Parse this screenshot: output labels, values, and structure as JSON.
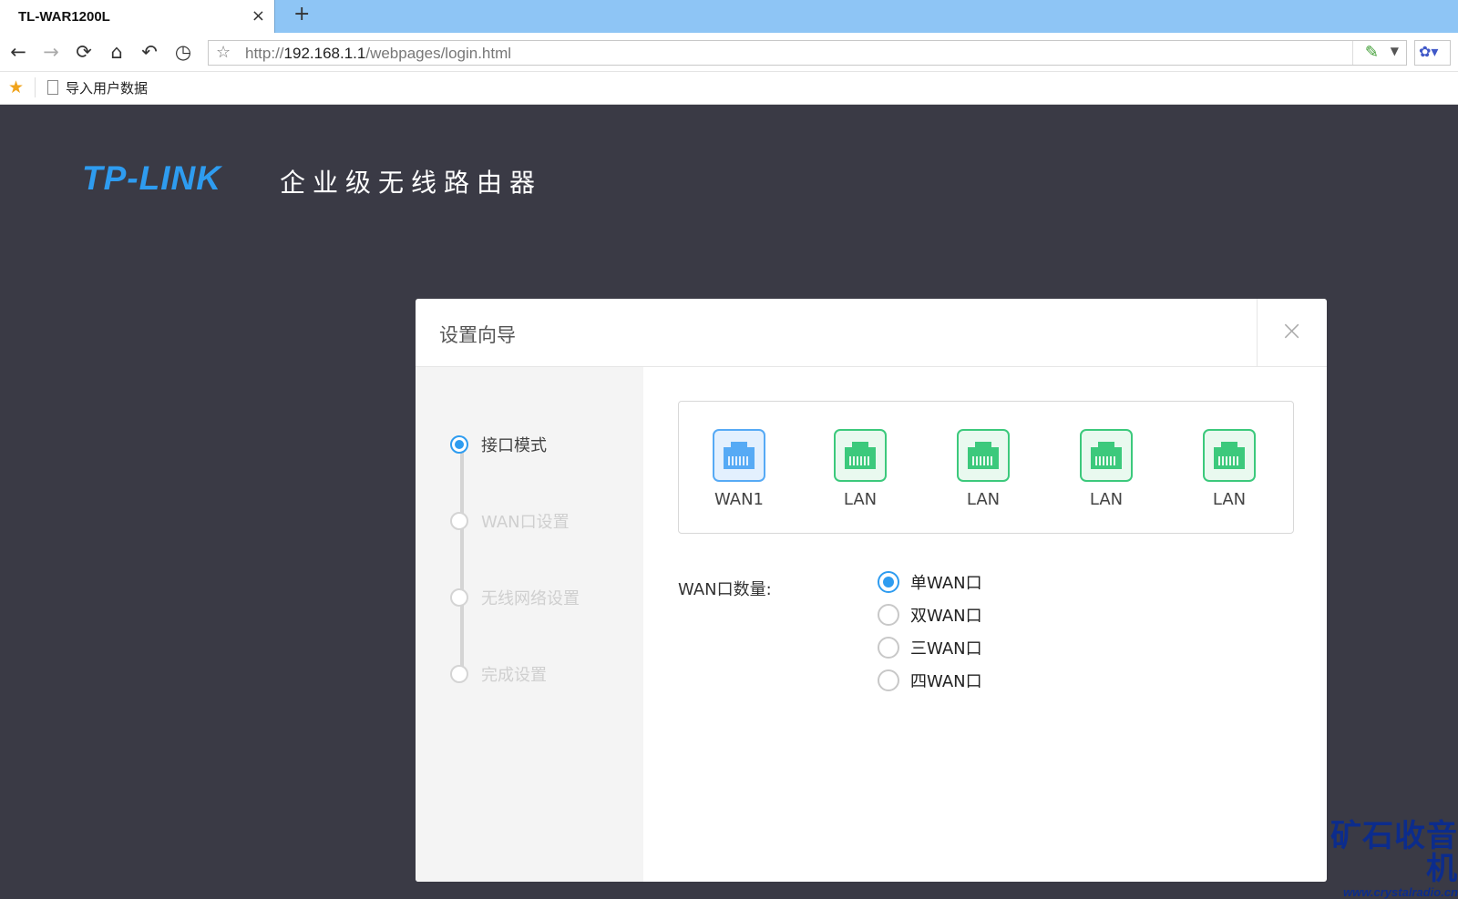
{
  "browser": {
    "tab_title": "TL-WAR1200L",
    "tab_close": "×",
    "new_tab": "+",
    "url_prefix": "http://",
    "url_host": "192.168.1.1",
    "url_path": "/webpages/login.html",
    "bookmark_label": "导入用户数据"
  },
  "header": {
    "logo": "TP-LINK",
    "product": "企业级无线路由器"
  },
  "modal": {
    "title": "设置向导",
    "close": "×",
    "steps": [
      {
        "label": "接口模式",
        "active": true
      },
      {
        "label": "WAN口设置",
        "active": false
      },
      {
        "label": "无线网络设置",
        "active": false
      },
      {
        "label": "完成设置",
        "active": false
      }
    ],
    "ports": [
      {
        "label": "WAN1",
        "type": "wan"
      },
      {
        "label": "LAN",
        "type": "lan"
      },
      {
        "label": "LAN",
        "type": "lan"
      },
      {
        "label": "LAN",
        "type": "lan"
      },
      {
        "label": "LAN",
        "type": "lan"
      }
    ],
    "wan_count_label": "WAN口数量:",
    "wan_options": [
      {
        "label": "单WAN口",
        "checked": true
      },
      {
        "label": "双WAN口",
        "checked": false
      },
      {
        "label": "三WAN口",
        "checked": false
      },
      {
        "label": "四WAN口",
        "checked": false
      }
    ]
  },
  "watermark": {
    "title": "矿石收音机",
    "url": "www.crystalradio.cn"
  },
  "colors": {
    "accent": "#2e9cf0",
    "lan_green": "#3cc97c",
    "page_bg": "#3a3a45"
  }
}
